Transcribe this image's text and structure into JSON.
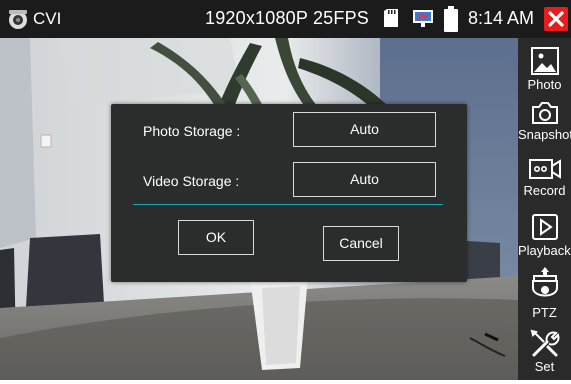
{
  "status_bar": {
    "mode": "CVI",
    "resolution": "1920x1080P 25FPS",
    "time": "8:14 AM",
    "close_color": "#e81c1c",
    "icons": [
      "camera-icon",
      "sd-card-icon",
      "monitor-icon",
      "battery-icon",
      "close-icon"
    ]
  },
  "sidebar": {
    "items": [
      {
        "label": "Photo",
        "icon": "photo-icon"
      },
      {
        "label": "Snapshot",
        "icon": "camera-icon"
      },
      {
        "label": "Record",
        "icon": "video-record-icon"
      },
      {
        "label": "Playback",
        "icon": "play-icon"
      },
      {
        "label": "PTZ",
        "icon": "ptz-camera-icon"
      },
      {
        "label": "Set",
        "icon": "tools-icon"
      }
    ]
  },
  "dialog": {
    "photo_storage_label": "Photo Storage :",
    "photo_storage_value": "Auto",
    "video_storage_label": "Video Storage :",
    "video_storage_value": "Auto",
    "ok_label": "OK",
    "cancel_label": "Cancel",
    "divider_color": "#1aa6b3"
  }
}
